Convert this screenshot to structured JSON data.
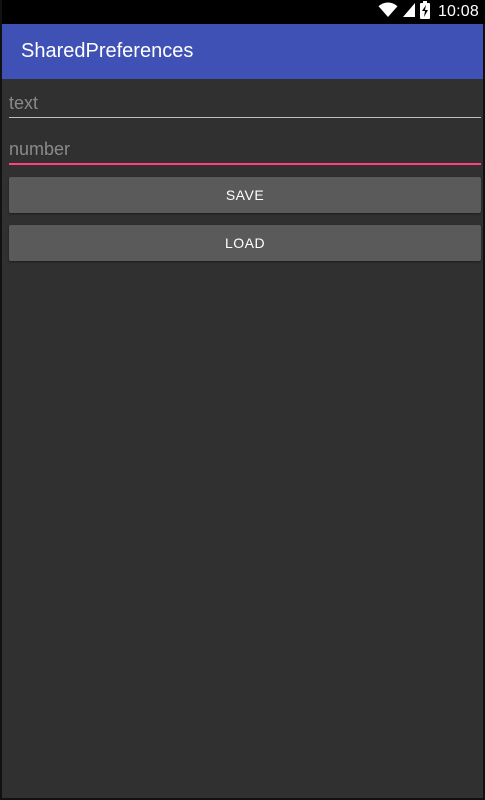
{
  "status_bar": {
    "time": "10:08",
    "icons": [
      "wifi-icon",
      "signal-icon",
      "battery-charging-icon"
    ]
  },
  "app_bar": {
    "title": "SharedPreferences",
    "color": "#3F51B5"
  },
  "form": {
    "text_field": {
      "placeholder": "text",
      "value": ""
    },
    "number_field": {
      "placeholder": "number",
      "value": "",
      "focused": true
    },
    "save_label": "SAVE",
    "load_label": "LOAD"
  },
  "colors": {
    "accent": "#FF4081",
    "background": "#303030",
    "button": "#5a5a5a"
  }
}
